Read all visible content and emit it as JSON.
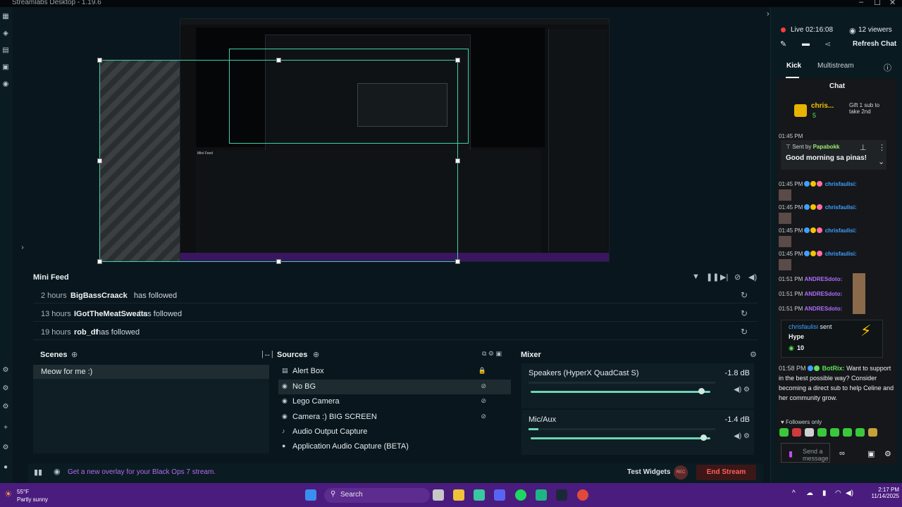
{
  "window": {
    "title": "Streamlabs Desktop - 1.19.6"
  },
  "mini_feed": {
    "title": "Mini Feed",
    "rows": [
      {
        "time": "2 hours",
        "name": "BigBassCraack",
        "action": "has followed"
      },
      {
        "time": "13 hours",
        "name": "IGotTheMeatSweats",
        "action": "has followed"
      },
      {
        "time": "19 hours",
        "name": "rob_df",
        "action": "has followed"
      }
    ]
  },
  "scenes": {
    "title": "Scenes",
    "items": [
      "Meow for me :)"
    ]
  },
  "sources": {
    "title": "Sources",
    "items": [
      {
        "name": "Alert Box"
      },
      {
        "name": "No BG"
      },
      {
        "name": "Lego Camera"
      },
      {
        "name": "Camera :) BIG SCREEN"
      },
      {
        "name": "Audio Output Capture"
      },
      {
        "name": "Application Audio Capture (BETA)"
      }
    ]
  },
  "mixer": {
    "title": "Mixer",
    "channels": [
      {
        "name": "Speakers (HyperX QuadCast S)",
        "db": "-1.8 dB",
        "volume": 0.95
      },
      {
        "name": "Mic/Aux",
        "db": "-1.4 dB",
        "volume": 0.96
      }
    ]
  },
  "bottom_bar": {
    "overlay_text": "Get a new overlay for your Black Ops 7 stream.",
    "test_widgets": "Test Widgets",
    "rec_label": "REC",
    "end_stream": "End Stream"
  },
  "chat_panel": {
    "live_label": "Live 02:16:08",
    "viewers": "12 viewers",
    "refresh_chat": "Refresh Chat",
    "tabs": [
      "Kick",
      "Multistream"
    ],
    "chat_title": "Chat",
    "top_user": "chris...",
    "top_user_count": "5",
    "gift_text": "Gift 1 sub to take 2nd",
    "pinned": {
      "sent_by_label": "Sent by",
      "sender": "Papabokk",
      "message": "Good morning sa pinas!"
    },
    "messages": [
      {
        "time": "01:45 PM",
        "name": "chrisfaulisi:"
      },
      {
        "time": "01:45 PM",
        "name": "chrisfaulisi:"
      },
      {
        "time": "01:45 PM",
        "name": "chrisfaulisi:"
      },
      {
        "time": "01:45 PM",
        "name": "chrisfaulisi:"
      }
    ],
    "andres": [
      {
        "time": "01:51 PM",
        "name": "ANDRESdoto:"
      },
      {
        "time": "01:51 PM",
        "name": "ANDRESdoto:"
      },
      {
        "time": "01:51 PM",
        "name": "ANDRESdoto:"
      }
    ],
    "hype": {
      "user": "chrisfaulisi",
      "sent": "sent",
      "item": "Hype",
      "count": "10"
    },
    "botrix": {
      "time": "01:58 PM",
      "name": "BotRix:",
      "text": "Want to support in the best possible way? Consider becoming a direct sub to help Celine and her community grow."
    },
    "followers_only": "Followers only",
    "send_placeholder": "Send a message"
  },
  "taskbar": {
    "temp": "55°F",
    "weather": "Partly sunny",
    "search": "Search",
    "time": "2:17 PM",
    "date": "11/14/2025"
  }
}
